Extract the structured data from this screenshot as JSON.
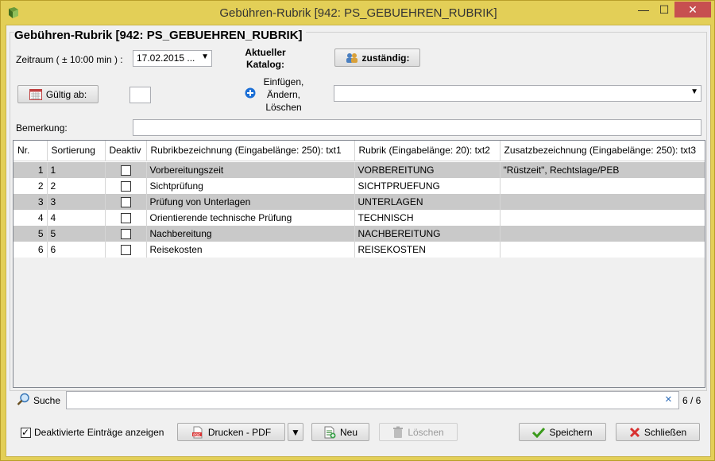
{
  "window": {
    "title": "Gebühren-Rubrik [942: PS_GEBUEHREN_RUBRIK]",
    "minimize": "—",
    "maximize": "☐",
    "close": "✕"
  },
  "heading": "Gebühren-Rubrik [942: PS_GEBUEHREN_RUBRIK]",
  "filters": {
    "zeitraum_label": "Zeitraum ( ± 10:00 min ) :",
    "zeitraum_value": "17.02.2015 ...",
    "catalog_label": "Aktueller Katalog:",
    "zustaendig_button": "zuständig:",
    "gueltig_button": "Gültig ab:",
    "gueltig_value": "",
    "insert_label": "Einfügen, Ändern, Löschen",
    "insert_combo_value": "",
    "bemerkung_label": "Bemerkung:",
    "bemerkung_value": ""
  },
  "table": {
    "columns": [
      "Nr.",
      "Sortierung",
      "Deaktiv",
      "Rubrikbezeichnung (Eingabelänge: 250): txt1",
      "Rubrik (Eingabelänge: 20): txt2",
      "Zusatzbezeichnung (Eingabelänge: 250): txt3"
    ],
    "rows": [
      {
        "nr": "1",
        "sort": "1",
        "deaktiv": false,
        "txt1": "Vorbereitungszeit",
        "txt2": "VORBEREITUNG",
        "txt3": "\"Rüstzeit\", Rechtslage/PEB"
      },
      {
        "nr": "2",
        "sort": "2",
        "deaktiv": false,
        "txt1": "Sichtprüfung",
        "txt2": "SICHTPRUEFUNG",
        "txt3": ""
      },
      {
        "nr": "3",
        "sort": "3",
        "deaktiv": false,
        "txt1": "Prüfung von Unterlagen",
        "txt2": "UNTERLAGEN",
        "txt3": ""
      },
      {
        "nr": "4",
        "sort": "4",
        "deaktiv": false,
        "txt1": "Orientierende technische Prüfung",
        "txt2": "TECHNISCH",
        "txt3": ""
      },
      {
        "nr": "5",
        "sort": "5",
        "deaktiv": false,
        "txt1": "Nachbereitung",
        "txt2": "NACHBEREITUNG",
        "txt3": ""
      },
      {
        "nr": "6",
        "sort": "6",
        "deaktiv": false,
        "txt1": "Reisekosten",
        "txt2": "REISEKOSTEN",
        "txt3": ""
      }
    ]
  },
  "search": {
    "label": "Suche",
    "value": "",
    "clear": "×",
    "count": "6 / 6"
  },
  "footer": {
    "show_deactivated_label": "Deaktivierte Einträge anzeigen",
    "show_deactivated_checked": true,
    "print_button": "Drucken - PDF",
    "new_button": "Neu",
    "delete_button": "Löschen",
    "save_button": "Speichern",
    "close_button": "Schließen"
  },
  "colors": {
    "frame": "#e3cf57",
    "row_alt": "#c9c9c9",
    "accent_blue": "#1c6fd6",
    "save_green": "#3a9a1a",
    "close_red": "#d83030"
  }
}
